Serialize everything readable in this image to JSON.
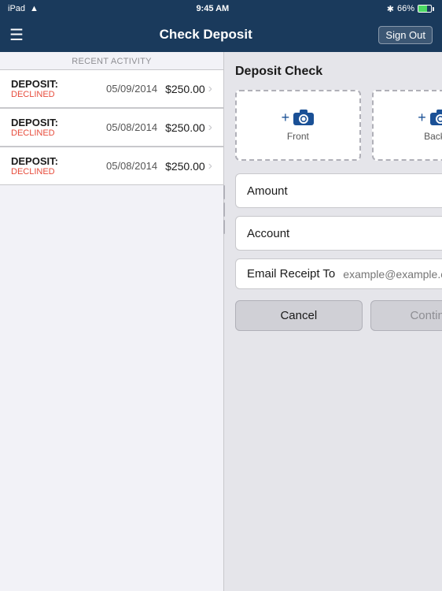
{
  "statusBar": {
    "carrier": "iPad",
    "wifi": "wifi",
    "time": "9:45 AM",
    "bluetooth": "BT",
    "battery": "66%",
    "battery_level": 66
  },
  "navBar": {
    "menu_icon": "☰",
    "title": "Check Deposit",
    "sign_out": "Sign Out"
  },
  "leftPanel": {
    "section_header": "RECENT ACTIVITY",
    "items": [
      {
        "type": "DEPOSIT:",
        "status": "DECLINED",
        "date": "05/09/2014",
        "amount": "$250.00"
      },
      {
        "type": "DEPOSIT:",
        "status": "DECLINED",
        "date": "05/08/2014",
        "amount": "$250.00"
      },
      {
        "type": "DEPOSIT:",
        "status": "DECLINED",
        "date": "05/08/2014",
        "amount": "$250.00"
      }
    ]
  },
  "rightPanel": {
    "title": "Deposit Check",
    "front_label": "Front",
    "back_label": "Back",
    "plus_symbol": "+",
    "amount_label": "Amount",
    "account_label": "Account",
    "email_label": "Email Receipt To",
    "email_placeholder": "example@example.com",
    "cancel_label": "Cancel",
    "continue_label": "Continue"
  }
}
